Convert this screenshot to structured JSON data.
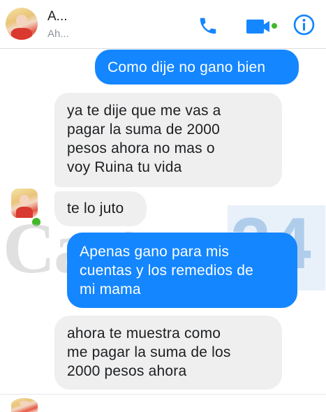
{
  "header": {
    "contact_name": "A...",
    "status": "Ah...",
    "icons": {
      "call": "phone-icon",
      "video": "video-camera-icon",
      "info": "info-icon"
    },
    "accent_color": "#1486ff"
  },
  "messages": [
    {
      "direction": "outgoing",
      "text": "Como dije no gano bien"
    },
    {
      "direction": "incoming",
      "text": "ya te dije que me vas a\npagar la suma de 2000\npesos ahora no mas o\nvoy Ruina tu vida"
    },
    {
      "direction": "incoming",
      "text": "te lo juto"
    },
    {
      "direction": "outgoing",
      "text": "Apenas gano para mis\ncuentas y los remedios de\nmi mama"
    },
    {
      "direction": "incoming",
      "text": "ahora te muestra como\nme pagar la suma de los\n2000 pesos ahora"
    }
  ],
  "watermark": {
    "word": "Castox",
    "number": "24"
  },
  "colors": {
    "outgoing_bubble": "#1486ff",
    "incoming_bubble": "#efefef",
    "online": "#42b72a"
  }
}
